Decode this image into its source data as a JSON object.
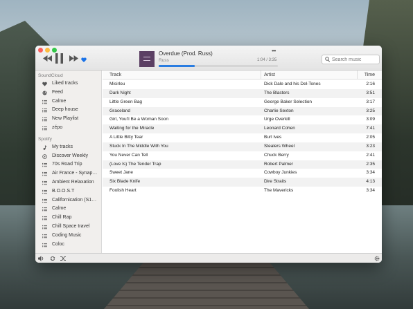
{
  "now_playing": {
    "title": "Overdue (Prod. Russ)",
    "artist": "Russ",
    "time": "1:04 / 3:35",
    "progress": 0.3,
    "more_label": "•••",
    "artwork_color": "#5b3f63"
  },
  "search": {
    "placeholder": "Search music"
  },
  "sidebar": {
    "sections": [
      {
        "title": "SoundCloud",
        "items": [
          {
            "label": "Liked tracks",
            "icon": "heart-icon"
          },
          {
            "label": "Feed",
            "icon": "globe-icon"
          },
          {
            "label": "Calme",
            "icon": "playlist-icon"
          },
          {
            "label": "Deep house",
            "icon": "playlist-icon"
          },
          {
            "label": "New Playlist",
            "icon": "playlist-icon"
          },
          {
            "label": "zépo",
            "icon": "playlist-icon"
          }
        ]
      },
      {
        "title": "Spotify",
        "items": [
          {
            "label": "My tracks",
            "icon": "music-icon"
          },
          {
            "label": "Discover Weekly",
            "icon": "compass-icon"
          },
          {
            "label": "70s Road Trip",
            "icon": "playlist-icon"
          },
          {
            "label": "Air France - Synap…",
            "icon": "playlist-icon"
          },
          {
            "label": "Ambient Relaxation",
            "icon": "playlist-icon"
          },
          {
            "label": "B.O.O.S.T",
            "icon": "playlist-icon"
          },
          {
            "label": "Californication (S1…",
            "icon": "playlist-icon"
          },
          {
            "label": "Calme",
            "icon": "playlist-icon"
          },
          {
            "label": "Chill Rap",
            "icon": "playlist-icon"
          },
          {
            "label": "Chill Space travel",
            "icon": "playlist-icon"
          },
          {
            "label": "Coding Music",
            "icon": "playlist-icon"
          },
          {
            "label": "Coloc",
            "icon": "playlist-icon"
          }
        ]
      }
    ]
  },
  "table": {
    "columns": [
      "Track",
      "Artist",
      "Time"
    ],
    "rows": [
      {
        "track": "Misirlou",
        "artist": "Dick Dale and his Del-Tones",
        "time": "2:16"
      },
      {
        "track": "Dark Night",
        "artist": "The Blasters",
        "time": "3:51"
      },
      {
        "track": "Little Green Bag",
        "artist": "George Baker Selection",
        "time": "3:17"
      },
      {
        "track": "Graceland",
        "artist": "Charlie Sexton",
        "time": "3:25"
      },
      {
        "track": "Girl, You'll Be a Woman Soon",
        "artist": "Urge Overkill",
        "time": "3:09"
      },
      {
        "track": "Waiting for the Miracle",
        "artist": "Leonard Cohen",
        "time": "7:41"
      },
      {
        "track": "A Little Bitty Tear",
        "artist": "Burl Ives",
        "time": "2:05"
      },
      {
        "track": "Stuck In The Middle With You",
        "artist": "Stealers Wheel",
        "time": "3:23"
      },
      {
        "track": "You Never Can Tell",
        "artist": "Chuck Berry",
        "time": "2:41"
      },
      {
        "track": "(Love Is) The Tender Trap",
        "artist": "Robert Palmer",
        "time": "2:35"
      },
      {
        "track": "Sweet Jane",
        "artist": "Cowboy Junkies",
        "time": "3:34"
      },
      {
        "track": "Six Blade Knife",
        "artist": "Dire Straits",
        "time": "4:13"
      },
      {
        "track": "Foolish Heart",
        "artist": "The Mavericks",
        "time": "3:34"
      }
    ]
  },
  "colors": {
    "accent": "#2a7de1",
    "heart": "#1a73e8"
  }
}
